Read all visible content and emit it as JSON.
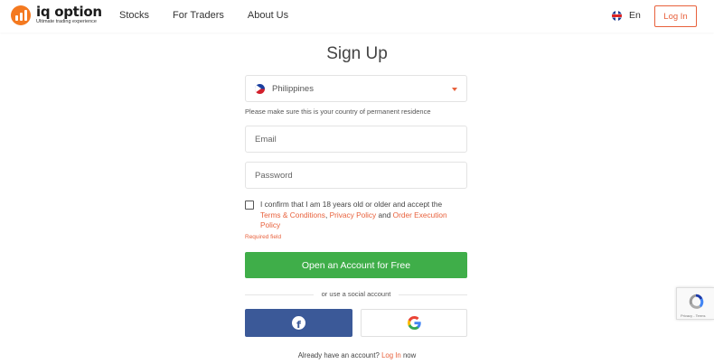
{
  "header": {
    "logo_name": "iq option",
    "logo_tagline": "Ultimate trading experience",
    "nav": [
      "Stocks",
      "For Traders",
      "About Us"
    ],
    "language": "En",
    "login_label": "Log In"
  },
  "signup": {
    "title": "Sign Up",
    "country": "Philippines",
    "country_hint": "Please make sure this is your country of permanent residence",
    "email_placeholder": "Email",
    "password_placeholder": "Password",
    "consent_prefix": "I confirm that I am 18 years old or older and accept the",
    "terms_link": "Terms & Conditions",
    "privacy_link": "Privacy Policy",
    "and_text": "and",
    "order_policy_link": "Order Execution Policy",
    "required_text": "Required field",
    "cta_label": "Open an Account for Free",
    "social_divider": "or use a social account",
    "already_text": "Already have an account?",
    "already_link": "Log In",
    "already_suffix": "now"
  },
  "recaptcha": {
    "label": "Privacy - Terms"
  },
  "colors": {
    "brand_orange": "#f47920",
    "accent": "#e8613c",
    "cta_green": "#3fae49",
    "facebook_blue": "#3b5998"
  }
}
